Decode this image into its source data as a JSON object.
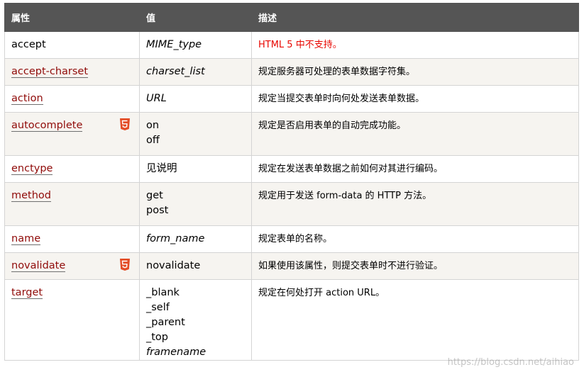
{
  "table": {
    "headers": [
      "属性",
      "值",
      "描述"
    ],
    "rows": [
      {
        "attr": "accept",
        "link": false,
        "html5": false,
        "values": [
          "MIME_type"
        ],
        "italic": [
          true
        ],
        "desc": "HTML 5 中不支持。",
        "desc_red": true
      },
      {
        "attr": "accept-charset",
        "link": true,
        "html5": false,
        "values": [
          "charset_list"
        ],
        "italic": [
          true
        ],
        "desc": "规定服务器可处理的表单数据字符集。",
        "desc_red": false
      },
      {
        "attr": "action",
        "link": true,
        "html5": false,
        "values": [
          "URL"
        ],
        "italic": [
          true
        ],
        "desc": "规定当提交表单时向何处发送表单数据。",
        "desc_red": false
      },
      {
        "attr": "autocomplete",
        "link": true,
        "html5": true,
        "values": [
          "on",
          "off"
        ],
        "italic": [
          false,
          false
        ],
        "desc": "规定是否启用表单的自动完成功能。",
        "desc_red": false
      },
      {
        "attr": "enctype",
        "link": true,
        "html5": false,
        "values": [
          "见说明"
        ],
        "italic": [
          false
        ],
        "desc": "规定在发送表单数据之前如何对其进行编码。",
        "desc_red": false
      },
      {
        "attr": "method",
        "link": true,
        "html5": false,
        "values": [
          "get",
          "post"
        ],
        "italic": [
          false,
          false
        ],
        "desc": "规定用于发送 form-data 的 HTTP 方法。",
        "desc_red": false
      },
      {
        "attr": "name",
        "link": true,
        "html5": false,
        "values": [
          "form_name"
        ],
        "italic": [
          true
        ],
        "desc": "规定表单的名称。",
        "desc_red": false
      },
      {
        "attr": "novalidate",
        "link": true,
        "html5": true,
        "values": [
          "novalidate"
        ],
        "italic": [
          false
        ],
        "desc": "如果使用该属性，则提交表单时不进行验证。",
        "desc_red": false
      },
      {
        "attr": "target",
        "link": true,
        "html5": false,
        "values": [
          "_blank",
          "_self",
          "_parent",
          "_top",
          "framename"
        ],
        "italic": [
          false,
          false,
          false,
          false,
          true
        ],
        "desc": "规定在何处打开 action URL。",
        "desc_red": false
      }
    ]
  },
  "watermark": "https://blog.csdn.net/aihiao",
  "colors": {
    "header_bg": "#555555",
    "link": "#900b09",
    "red_text": "#e80600",
    "html5_badge": "#e34c26",
    "row_alt": "#f6f4f0"
  },
  "icons": {
    "html5": "html5-badge-icon"
  }
}
